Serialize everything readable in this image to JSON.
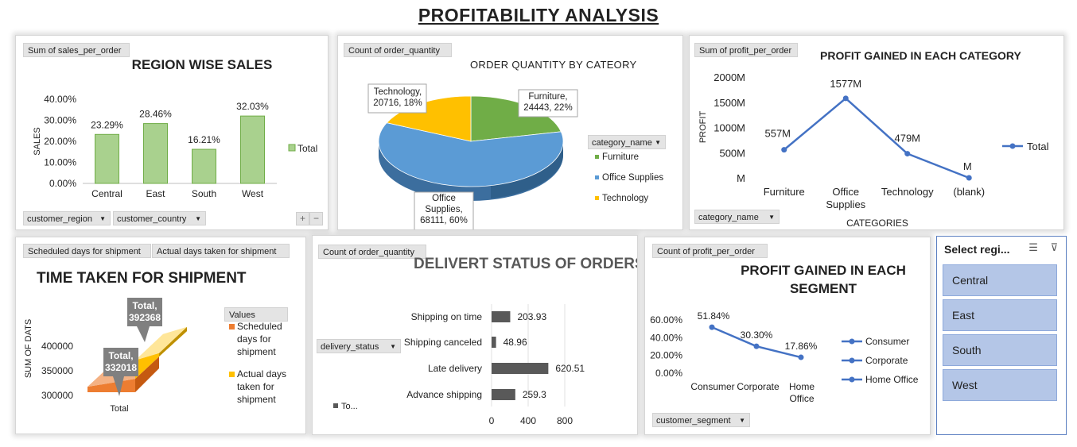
{
  "page": {
    "title": "PROFITABILITY  ANALYSIS"
  },
  "chart_data": [
    {
      "type": "bar",
      "title": "REGION WISE SALES",
      "field_button": "Sum of sales_per_order",
      "ylabel": "SALES",
      "categories": [
        "Central",
        "East",
        "South",
        "West"
      ],
      "values": [
        23.29,
        28.46,
        16.21,
        32.03
      ],
      "value_labels": [
        "23.29%",
        "28.46%",
        "16.21%",
        "32.03%"
      ],
      "yticks": [
        "0.00%",
        "10.00%",
        "20.00%",
        "30.00%",
        "40.00%"
      ],
      "ylim": [
        0,
        40
      ],
      "legend": "Total",
      "filters": [
        "customer_region",
        "customer_country"
      ],
      "colors": {
        "bar": "#a9d18e",
        "bar_border": "#70ad47"
      }
    },
    {
      "type": "pie",
      "title": "ORDER QUANTITY BY CATEORY",
      "field_button": "Count of order_quantity",
      "legend_title": "category_name",
      "slices": [
        {
          "name": "Furniture",
          "value": 24443,
          "label": "Furniture,\n24443, 22%",
          "color": "#70ad47"
        },
        {
          "name": "Office Supplies",
          "value": 68111,
          "label": "Office\nSupplies,\n68111, 60%",
          "color": "#5b9bd5"
        },
        {
          "name": "Technology",
          "value": 20716,
          "label": "Technology,\n20716, 18%",
          "color": "#ffc000"
        }
      ]
    },
    {
      "type": "line",
      "title": "PROFIT GAINED IN EACH CATEGORY",
      "field_button": "Sum of profit_per_order",
      "xlabel": "CATEGORIES",
      "ylabel": "PROFIT",
      "categories": [
        "Furniture",
        "Office\nSupplies",
        "Technology",
        "(blank)"
      ],
      "values": [
        557,
        1577,
        479,
        0
      ],
      "value_labels": [
        "557M",
        "1577M",
        "479M",
        "M"
      ],
      "yticks": [
        "M",
        "500M",
        "1000M",
        "1500M",
        "2000M"
      ],
      "ylim": [
        0,
        2000
      ],
      "legend": "Total",
      "filter": "category_name",
      "colors": {
        "line": "#4472c4"
      }
    },
    {
      "type": "bar",
      "title": "TIME TAKEN FOR SHIPMENT",
      "field_buttons": [
        "Scheduled days for shipment",
        "Actual days taken for shipment"
      ],
      "ylabel": "SUM OF DATS",
      "categories": [
        "Total"
      ],
      "series": [
        {
          "name": "Scheduled days for shipment",
          "value": 332018,
          "label": "Total,\n332018",
          "color": "#ed7d31"
        },
        {
          "name": "Actual days taken for shipment",
          "value": 392368,
          "label": "Total,\n392368",
          "color": "#ffc000"
        }
      ],
      "yticks": [
        "300000",
        "350000",
        "400000"
      ],
      "legend_title": "Values",
      "legend_entries": [
        "Scheduled\ndays for\nshipment",
        "Actual days\ntaken for\nshipment"
      ]
    },
    {
      "type": "bar",
      "title": "DELIVERT STATUS OF ORDERS",
      "field_button": "Count of order_quantity",
      "categories": [
        "Shipping on time",
        "Shipping canceled",
        "Late delivery",
        "Advance shipping"
      ],
      "values": [
        203.93,
        48.96,
        620.51,
        259.3
      ],
      "value_labels": [
        "203.93",
        "48.96",
        "620.51",
        "259.3"
      ],
      "xticks": [
        "0",
        "400",
        "800"
      ],
      "xlim": [
        0,
        800
      ],
      "filter": "delivery_status",
      "legend": "To...",
      "colors": {
        "bar": "#595959"
      }
    },
    {
      "type": "line",
      "title": "PROFIT GAINED IN EACH\nSEGMENT",
      "field_button": "Count of profit_per_order",
      "categories": [
        "Consumer",
        "Corporate",
        "Home\nOffice"
      ],
      "values": [
        51.84,
        30.3,
        17.86
      ],
      "value_labels": [
        "51.84%",
        "30.30%",
        "17.86%"
      ],
      "yticks": [
        "0.00%",
        "20.00%",
        "40.00%",
        "60.00%"
      ],
      "ylim": [
        0,
        60
      ],
      "legend": [
        "Consumer",
        "Corporate",
        "Home Office"
      ],
      "filter": "customer_segment",
      "colors": {
        "line": "#4472c4"
      }
    }
  ],
  "slicer": {
    "title": "Select regi...",
    "icons": [
      "multi-select-icon",
      "clear-filter-icon"
    ],
    "items": [
      "Central",
      "East",
      "South",
      "West"
    ]
  }
}
